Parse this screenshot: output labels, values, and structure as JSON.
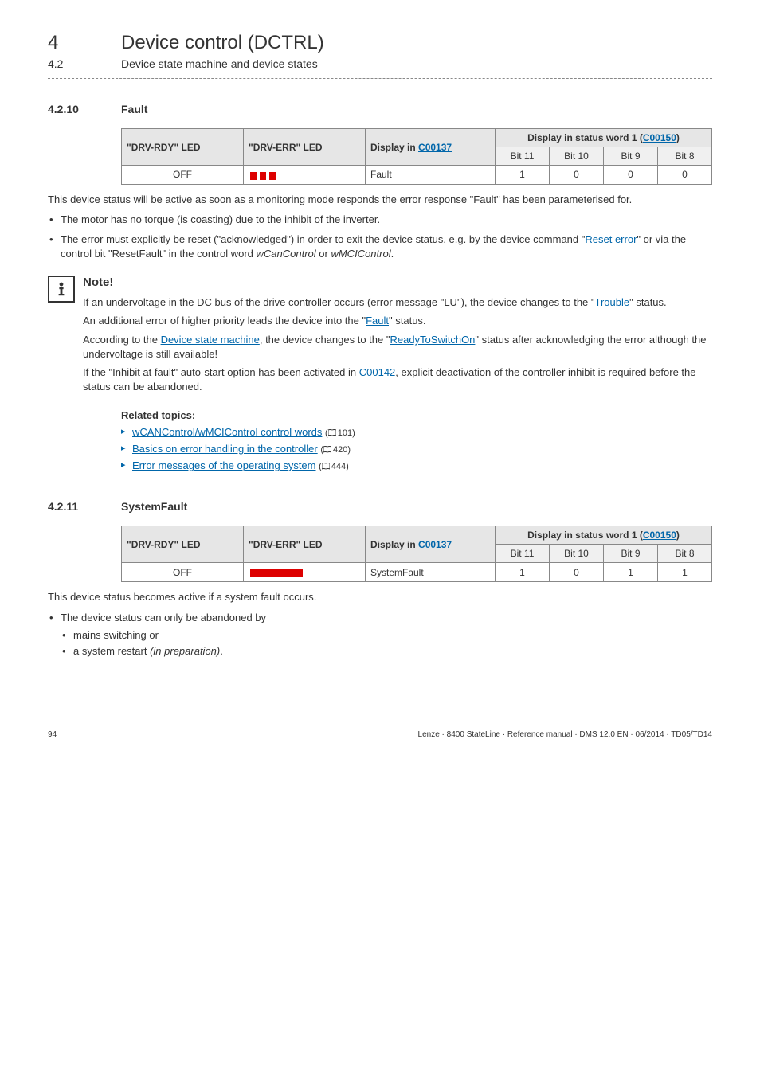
{
  "header": {
    "chapter_num": "4",
    "chapter_title": "Device control (DCTRL)",
    "sub_num": "4.2",
    "sub_title": "Device state machine and device states"
  },
  "section1": {
    "num": "4.2.10",
    "title": "Fault",
    "table": {
      "col1": "\"DRV-RDY\" LED",
      "col2": "\"DRV-ERR\" LED",
      "col3_pre": "Display in ",
      "col3_link": "C00137",
      "col4_pre": "Display in status word 1 (",
      "col4_link": "C00150",
      "col4_post": ")",
      "bit11": "Bit 11",
      "bit10": "Bit 10",
      "bit9": "Bit 9",
      "bit8": "Bit 8",
      "row": {
        "rdy": "OFF",
        "display": "Fault",
        "b11": "1",
        "b10": "0",
        "b9": "0",
        "b8": "0"
      }
    },
    "intro_p": "This device status will be active as soon as a monitoring mode responds the error response \"Fault\" has been parameterised for.",
    "bullets": {
      "b1": "The motor has no torque (is coasting) due to the inhibit of the inverter.",
      "b2_pre": "The error must explicitly be reset (\"acknowledged\") in order to exit the device status, e.g. by the device command \"",
      "b2_link": "Reset error",
      "b2_mid": "\" or via the control bit \"ResetFault\" in the control word ",
      "b2_it1": "wCanControl",
      "b2_or": " or ",
      "b2_it2": "wMCIControl",
      "b2_end": "."
    },
    "note": {
      "title": "Note!",
      "p1_pre": "If an undervoltage in the DC bus of the drive controller occurs (error message \"LU\"), the device changes to the \"",
      "p1_link": "Trouble",
      "p1_post": "\" status.",
      "p2_pre": "An additional error of higher priority leads the device into the \"",
      "p2_link": "Fault",
      "p2_post": "\" status.",
      "p3_pre": "According to the ",
      "p3_link1": "Device state machine",
      "p3_mid": ", the device changes to the \"",
      "p3_link2": "ReadyToSwitchOn",
      "p3_post": "\" status after acknowledging the error although the undervoltage is still available!",
      "p4_pre": "If the \"Inhibit at fault\" auto-start option has been activated in ",
      "p4_link": "C00142",
      "p4_post": ",  explicit deactivation of the controller inhibit is required before the status can be abandoned."
    },
    "related": {
      "title": "Related topics:",
      "r1_link": "wCANControl/wMCIControl control words",
      "r1_page": "101",
      "r2_link": "Basics on error handling in the controller",
      "r2_page": "420",
      "r3_link": "Error messages of the operating system",
      "r3_page": "444"
    }
  },
  "section2": {
    "num": "4.2.11",
    "title": "SystemFault",
    "table": {
      "row": {
        "rdy": "OFF",
        "display": "SystemFault",
        "b11": "1",
        "b10": "0",
        "b9": "1",
        "b8": "1"
      }
    },
    "p": "This device status becomes active if a system fault occurs.",
    "b1": "The device status can only be abandoned by",
    "sb1": "mains switching or",
    "sb2_pre": "a system restart ",
    "sb2_it": "(in preparation)",
    "sb2_end": "."
  },
  "footer": {
    "page": "94",
    "right": "Lenze · 8400 StateLine · Reference manual · DMS 12.0 EN · 06/2014 · TD05/TD14"
  }
}
